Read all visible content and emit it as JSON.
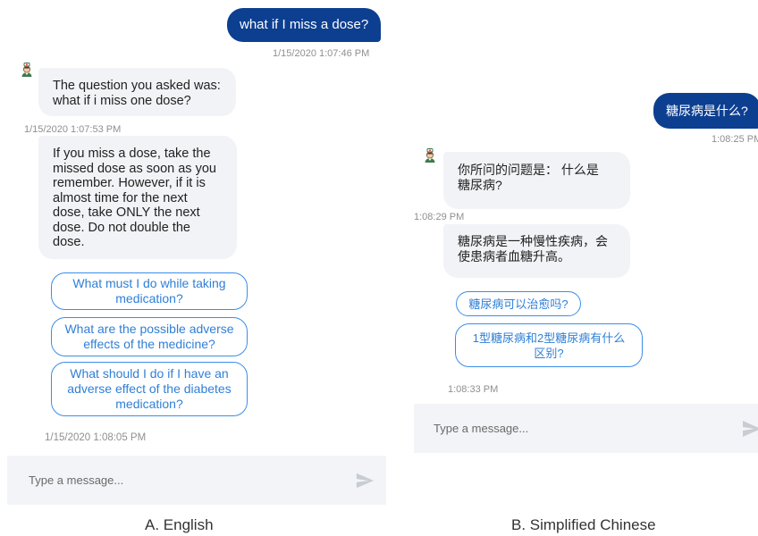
{
  "english": {
    "user_message": "what if I miss a dose?",
    "user_time": "1/15/2020 1:07:46 PM",
    "bot_restated_question": "The question you asked was: what if i miss one dose?",
    "bot_time": "1/15/2020 1:07:53 PM",
    "bot_answer": "If you miss a dose, take the missed dose as soon as you remember. However, if it is almost time for the next dose, take ONLY the next dose. Do not double the dose.",
    "suggestions": [
      "What must I do while taking medication?",
      "What are the possible adverse effects of the medicine?",
      "What should I do if I have an adverse effect of the diabetes medication?"
    ],
    "suggestions_time": "1/15/2020 1:08:05 PM",
    "input_placeholder": "Type a message...",
    "caption": "A. English"
  },
  "chinese": {
    "user_message": "糖尿病是什么?",
    "user_time": "1:08:25 PM",
    "bot_restated_question": "你所问的问题是： 什么是糖尿病?",
    "bot_time": "1:08:29 PM",
    "bot_answer": "糖尿病是一种慢性疾病，会使患病者血糖升高。",
    "suggestions": [
      "糖尿病可以治愈吗?",
      "1型糖尿病和2型糖尿病有什么区别?"
    ],
    "suggestions_time": "1:08:33 PM",
    "input_placeholder": "Type a message...",
    "caption": "B. Simplified Chinese"
  },
  "icons": {
    "bot_avatar": "doctor-avatar-icon",
    "send": "send-icon"
  },
  "colors": {
    "user_bubble": "#0d3f91",
    "bot_bubble": "#f1f3f6",
    "suggestion_border": "#3a8ee6",
    "suggestion_text": "#2f7fd6",
    "composer_bg": "#f3f4f7"
  }
}
